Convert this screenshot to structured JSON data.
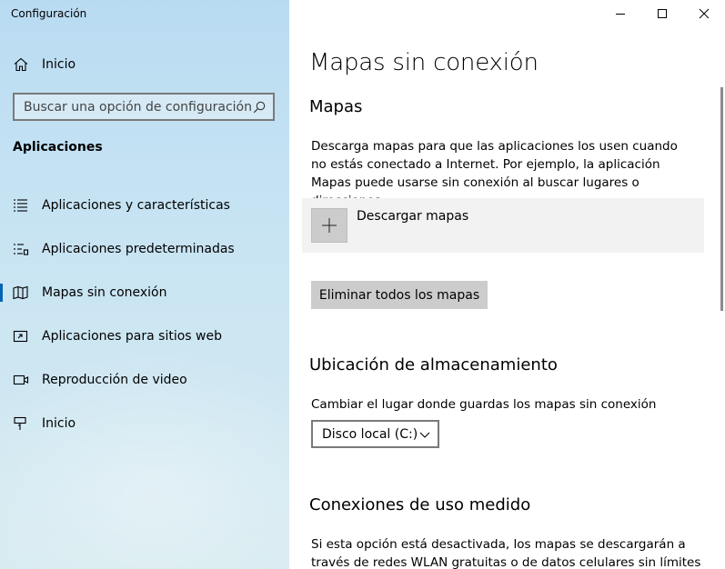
{
  "window": {
    "title": "Configuración",
    "controls": [
      "minimize-icon",
      "maximize-icon",
      "close-icon"
    ]
  },
  "sidebar": {
    "home_label": "Inicio",
    "search_placeholder": "Buscar una opción de configuración",
    "section_heading": "Aplicaciones",
    "items": [
      {
        "label": "Aplicaciones y características",
        "icon": "apps-features-icon",
        "selected": false
      },
      {
        "label": "Aplicaciones predeterminadas",
        "icon": "default-apps-icon",
        "selected": false
      },
      {
        "label": "Mapas sin conexión",
        "icon": "offline-maps-icon",
        "selected": true
      },
      {
        "label": "Aplicaciones para sitios web",
        "icon": "apps-websites-icon",
        "selected": false
      },
      {
        "label": "Reproducción de video",
        "icon": "video-playback-icon",
        "selected": false
      },
      {
        "label": "Inicio",
        "icon": "startup-icon",
        "selected": false
      }
    ],
    "accent_color": "#0063b1"
  },
  "main": {
    "page_title": "Mapas sin conexión",
    "maps": {
      "heading": "Mapas",
      "description": "Descarga mapas para que las aplicaciones los usen cuando no estás conectado a Internet. Por ejemplo, la aplicación Mapas puede usarse sin conexión al buscar lugares o direcciones.",
      "download_label": "Descargar mapas",
      "delete_all_label": "Eliminar todos los mapas"
    },
    "storage": {
      "heading": "Ubicación de almacenamiento",
      "description": "Cambiar el lugar donde guardas los mapas sin conexión",
      "selected_drive": "Disco local (C:)"
    },
    "metered": {
      "heading": "Conexiones de uso medido",
      "description": "Si esta opción está desactivada, los mapas se descargarán a través de redes WLAN gratuitas o de datos celulares sin límites"
    }
  }
}
